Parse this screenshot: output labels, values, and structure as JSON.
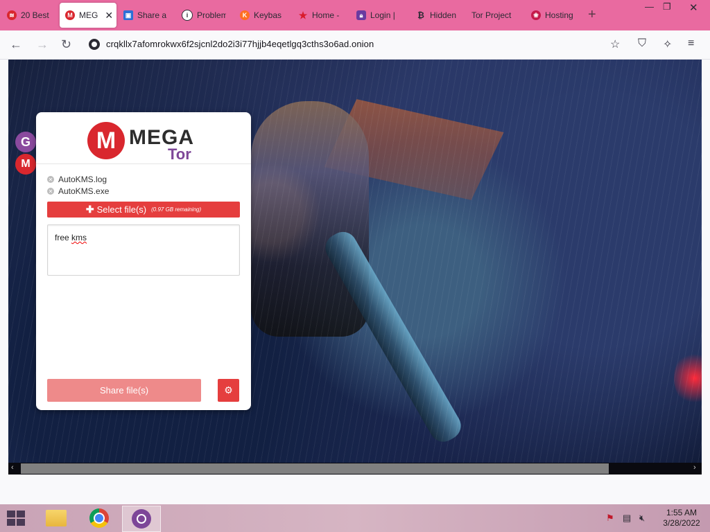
{
  "browser": {
    "tabs": [
      {
        "label": "20 Best",
        "favicon": "tab-favicon-icon",
        "color": "#d9272e"
      },
      {
        "label": "MEG",
        "favicon": "mega-icon",
        "color": "#d9272e",
        "active": true
      },
      {
        "label": "Share a",
        "favicon": "tab-favicon-icon",
        "color": "#2d6fd6"
      },
      {
        "label": "Problem",
        "favicon": "info-circle-icon",
        "color": "#2b2a33"
      },
      {
        "label": "Keybas",
        "favicon": "keybase-icon",
        "color": "#ff6f21"
      },
      {
        "label": "Home -",
        "favicon": "star-icon",
        "color": "#d81b2c"
      },
      {
        "label": "Login |",
        "favicon": "lock-icon",
        "color": "#6a3aa0"
      },
      {
        "label": "Hidden",
        "favicon": "bitcoin-icon",
        "color": "#2b2a33"
      },
      {
        "label": "Tor Project",
        "favicon": "",
        "color": ""
      },
      {
        "label": "Hosting",
        "favicon": "raspberry-icon",
        "color": "#c51a4a"
      }
    ],
    "new_tab_symbol": "+",
    "close_symbol": "✕",
    "url": "crqkllx7afomrokwx6f2sjcnl2do2i3i77hjjb4eqetlgq3cths3o6ad.onion"
  },
  "sidebar_badges": {
    "g": "G",
    "m": "M"
  },
  "mega": {
    "logo_mark": "M",
    "logo_word": "MEGA",
    "logo_sub": "Tor",
    "files": [
      "AutoKMS.log",
      "AutoKMS.exe"
    ],
    "select_label": "Select file(s)",
    "remaining": "(0.97 GB remaining)",
    "message_plain": "free ",
    "message_misspelled": "kms",
    "share_label": "Share file(s)",
    "settings_glyph": "⚙"
  },
  "taskbar": {
    "time": "1:55 AM",
    "date": "3/28/2022"
  },
  "colors": {
    "tab_strip": "#e96aa0",
    "mega_red": "#e53e3e",
    "share_disabled": "#ee8a8a",
    "tor_purple": "#7e4798"
  }
}
